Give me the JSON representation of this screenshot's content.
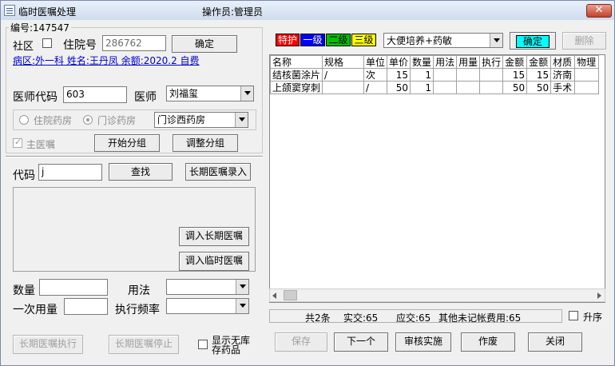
{
  "window": {
    "title": "临时医嘱处理",
    "operator": "操作员:管理员",
    "close_label": "✕"
  },
  "left": {
    "order_no": "编号:147547",
    "community_label": "社区",
    "inpatient_no_label": "住院号",
    "inpatient_no_value": "286762",
    "confirm_label": "确定",
    "patient_info": "病区:外一科 姓名:王丹凤 余额:2020.2 自费",
    "doctor_code_label": "医师代码",
    "doctor_code_value": "603",
    "doctor_label": "医师",
    "doctor_value": "刘福玺",
    "pharmacy_inpatient_label": "住院药房",
    "pharmacy_outpatient_label": "门诊药房",
    "pharmacy_select_value": "门诊西药房",
    "main_order_label": "主医嘱",
    "start_group_label": "开始分组",
    "adjust_group_label": "调整分组",
    "code_label": "代码",
    "code_value": "j",
    "search_label": "查找",
    "long_term_entry_label": "长期医嘱录入",
    "import_long_term_label": "调入长期医嘱",
    "import_temp_label": "调入临时医嘱",
    "quantity_label": "数量",
    "usage_label": "用法",
    "single_dose_label": "一次用量",
    "frequency_label": "执行频率"
  },
  "right": {
    "tags": [
      {
        "label": "特护",
        "bg": "#ff0000",
        "fg": "#ffffff"
      },
      {
        "label": "一级",
        "bg": "#0000ff",
        "fg": "#ffffff"
      },
      {
        "label": "二级",
        "bg": "#00c000",
        "fg": "#000000"
      },
      {
        "label": "三级",
        "bg": "#ffff00",
        "fg": "#000000"
      }
    ],
    "order_type_value": "大便培养+药敏",
    "confirm_label": "确定",
    "delete_label": "删除",
    "columns": [
      "名称",
      "规格",
      "单位",
      "单价",
      "数量",
      "用法",
      "用量",
      "执行",
      "金额",
      "金额",
      "材质",
      "物理"
    ],
    "rows": [
      [
        "结核菌涂片",
        "/",
        "次",
        "15",
        "1",
        "",
        "",
        "",
        "15",
        "15",
        "济南",
        ""
      ],
      [
        "上颌窦穿刺",
        "",
        "/",
        "50",
        "1",
        "",
        "",
        "",
        "50",
        "50",
        "手术",
        ""
      ]
    ],
    "status": {
      "count": "共2条",
      "actual": "实交:65",
      "due": "应交:65",
      "other": "其他未记帐费用:65"
    },
    "ascending_label": "升序"
  },
  "bottom": {
    "long_exec_label": "长期医嘱执行",
    "long_stop_label": "长期医嘱停止",
    "show_no_stock_label": "显示无库存药品",
    "save_label": "保存",
    "next_label": "下一个",
    "review_label": "审核实施",
    "void_label": "作废",
    "close_label": "关闭"
  }
}
